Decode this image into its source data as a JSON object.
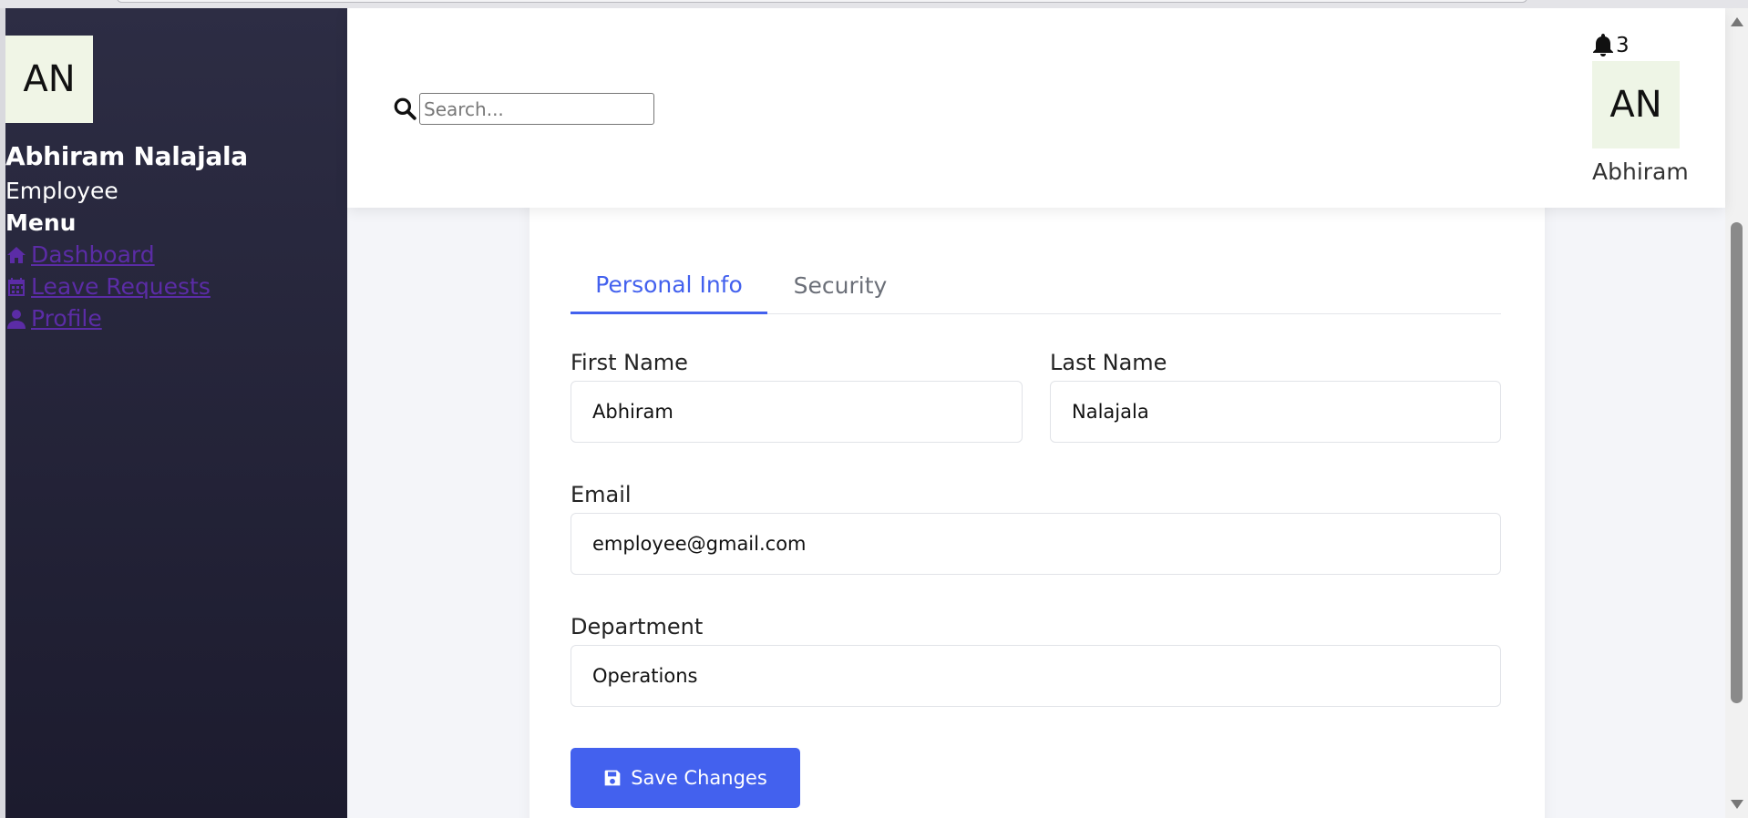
{
  "sidebar": {
    "avatar_initials": "AN",
    "user_name": "Abhiram Nalajala",
    "user_role": "Employee",
    "menu_heading": "Menu",
    "items": [
      {
        "label": "Dashboard",
        "icon": "home-icon"
      },
      {
        "label": "Leave Requests",
        "icon": "calendar-icon"
      },
      {
        "label": "Profile",
        "icon": "user-icon"
      }
    ]
  },
  "header": {
    "search_placeholder": "Search...",
    "search_icon": "search-icon",
    "notification_count": "3",
    "notification_icon": "bell-icon",
    "avatar_initials": "AN",
    "user_first_name": "Abhiram"
  },
  "profile": {
    "tabs": [
      {
        "label": "Personal Info",
        "active": true
      },
      {
        "label": "Security",
        "active": false
      }
    ],
    "fields": {
      "first_name": {
        "label": "First Name",
        "value": "Abhiram"
      },
      "last_name": {
        "label": "Last Name",
        "value": "Nalajala"
      },
      "email": {
        "label": "Email",
        "value": "employee@gmail.com"
      },
      "department": {
        "label": "Department",
        "value": "Operations"
      }
    },
    "save_label": "Save Changes",
    "save_icon": "save-icon"
  },
  "colors": {
    "accent": "#4361ee",
    "sidebar_top": "#2d2d44",
    "sidebar_bottom": "#1c1b2e",
    "link": "#5b2ca6",
    "avatar_bg": "#f0f5e6"
  }
}
